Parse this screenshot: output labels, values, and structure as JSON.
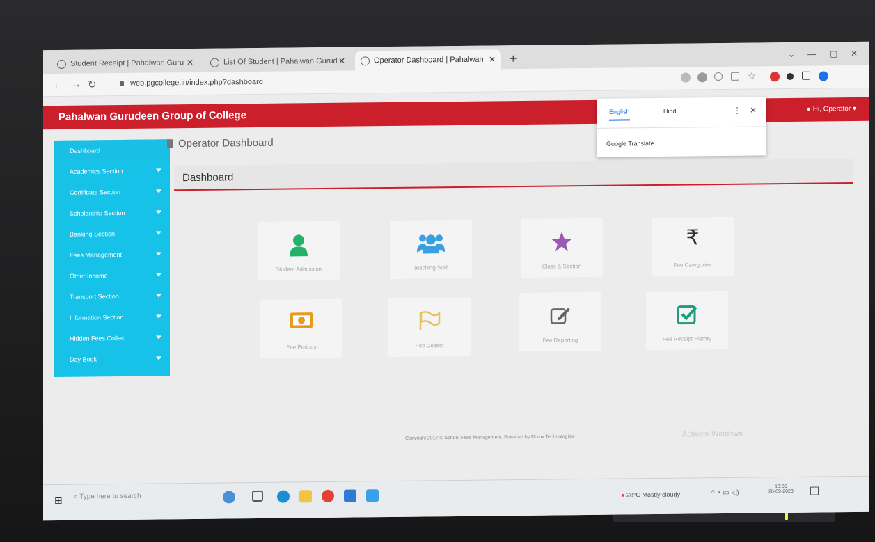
{
  "browser": {
    "tabs": [
      {
        "label": "Student Receipt | Pahalwan Guru"
      },
      {
        "label": "List Of Student | Pahalwan Gurud"
      },
      {
        "label": "Operator Dashboard | Pahalwan"
      }
    ],
    "url": "web.pgcollege.in/index.php?dashboard"
  },
  "app": {
    "brand": "Pahalwan Gurudeen Group of College",
    "user": "Hi, Operator"
  },
  "translate": {
    "tab_english": "English",
    "tab_hindi": "Hindi",
    "title": "Google Translate"
  },
  "sidebar": {
    "items": [
      {
        "label": "Dashboard"
      },
      {
        "label": "Academics Section"
      },
      {
        "label": "Certificate Section"
      },
      {
        "label": "Scholarship Section"
      },
      {
        "label": "Banking Section"
      },
      {
        "label": "Fees Management"
      },
      {
        "label": "Other Income"
      },
      {
        "label": "Transport Section"
      },
      {
        "label": "Information Section"
      },
      {
        "label": "Hidden Fees Collect"
      },
      {
        "label": "Day Book"
      }
    ]
  },
  "main": {
    "page_title": "Operator Dashboard",
    "panel_title": "Dashboard",
    "tiles": [
      {
        "label": "Student Admission",
        "icon": "user-icon"
      },
      {
        "label": "Teaching Staff",
        "icon": "users-icon"
      },
      {
        "label": "Class & Section",
        "icon": "star-icon"
      },
      {
        "label": "Fee Categories",
        "icon": "rupee-icon"
      },
      {
        "label": "Fee Periods",
        "icon": "money-icon"
      },
      {
        "label": "Fee Collect",
        "icon": "flag-icon"
      },
      {
        "label": "Fee Reporting",
        "icon": "edit-icon"
      },
      {
        "label": "Fee Receipt History",
        "icon": "check-square-icon"
      }
    ],
    "footer": "Copyright 2017 © School Fees Management. Powered by Dhruv Technologies",
    "activate": "Activate Windows"
  },
  "taskbar": {
    "search_placeholder": "Type here to search",
    "weather": "28°C  Mostly cloudy",
    "time": "13:05",
    "date": "28-09-2023"
  },
  "colors": {
    "brand_red": "#cc1f2c",
    "sidebar_cyan": "#17c2e8"
  }
}
